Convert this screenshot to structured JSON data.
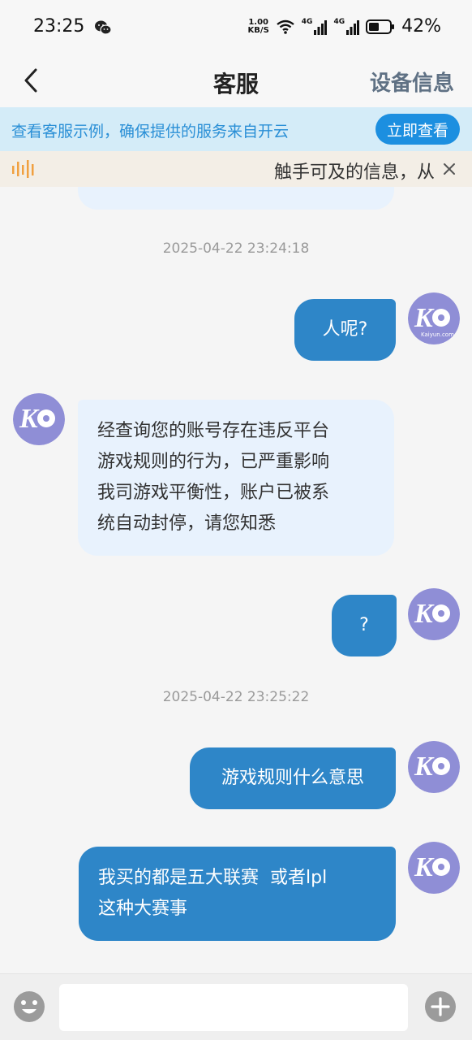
{
  "status_bar": {
    "time": "23:25",
    "net_speed_top": "1.00",
    "net_speed_bottom": "KB/S",
    "signal_1": "4G",
    "signal_2": "4G",
    "battery": "42%"
  },
  "nav": {
    "title": "客服",
    "device_info_label": "设备信息"
  },
  "notice": {
    "text": "查看客服示例，确保提供的服务来自开云",
    "button_label": "立即查看"
  },
  "marquee": {
    "text": "触手可及的信息，从"
  },
  "chat": {
    "timestamps": [
      "2025-04-22 23:24:18",
      "2025-04-22 23:25:22"
    ],
    "messages": [
      {
        "from": "user",
        "lines": [
          "人呢?"
        ]
      },
      {
        "from": "agent",
        "lines": [
          "经查询您的账号存在违反平台",
          "游戏规则的行为，已严重影响",
          "我司游戏平衡性，账户已被系",
          "统自动封停，请您知悉"
        ]
      },
      {
        "from": "user",
        "lines": [
          "?"
        ]
      },
      {
        "from": "user",
        "lines": [
          "游戏规则什么意思"
        ]
      },
      {
        "from": "user",
        "lines": [
          "我买的都是五大联赛  或者lpl",
          "这种大赛事"
        ]
      }
    ],
    "avatar_brand": "Kaiyun.com"
  },
  "input": {
    "placeholder": ""
  },
  "colors": {
    "accent": "#1c8fe0",
    "user_bubble": "#2e86c8",
    "agent_bubble": "#e8f2fd",
    "avatar": "#8f8ed6"
  }
}
